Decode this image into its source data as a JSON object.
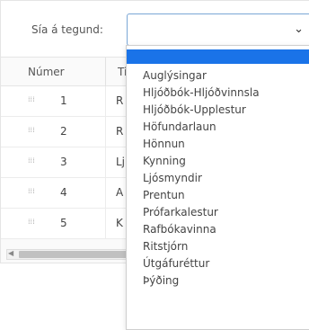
{
  "filter": {
    "label": "Sía á tegund:",
    "selected_value": "",
    "chevron_icon": "chevron-down-icon"
  },
  "grid": {
    "columns": [
      "Númer",
      "Ti"
    ],
    "rows": [
      {
        "number": "1",
        "title": "R"
      },
      {
        "number": "2",
        "title": "R"
      },
      {
        "number": "3",
        "title": "Lj"
      },
      {
        "number": "4",
        "title": "A"
      },
      {
        "number": "5",
        "title": "K"
      }
    ],
    "drag_icon": "drag-handle-icon"
  },
  "dropdown": {
    "highlighted_option": "",
    "options": [
      "Auglýsingar",
      "Hljóðbók-Hljóðvinnsla",
      "Hljóðbók-Upplestur",
      "Höfundarlaun",
      "Hönnun",
      "Kynning",
      "Ljósmyndir",
      "Prentun",
      "Prófarkalestur",
      "Rafbókavinna",
      "Ritstjórn",
      "Útgáfuréttur",
      "Þýðing"
    ]
  },
  "colors": {
    "highlight": "#1a73e8",
    "select_border": "#7aa7d6"
  }
}
